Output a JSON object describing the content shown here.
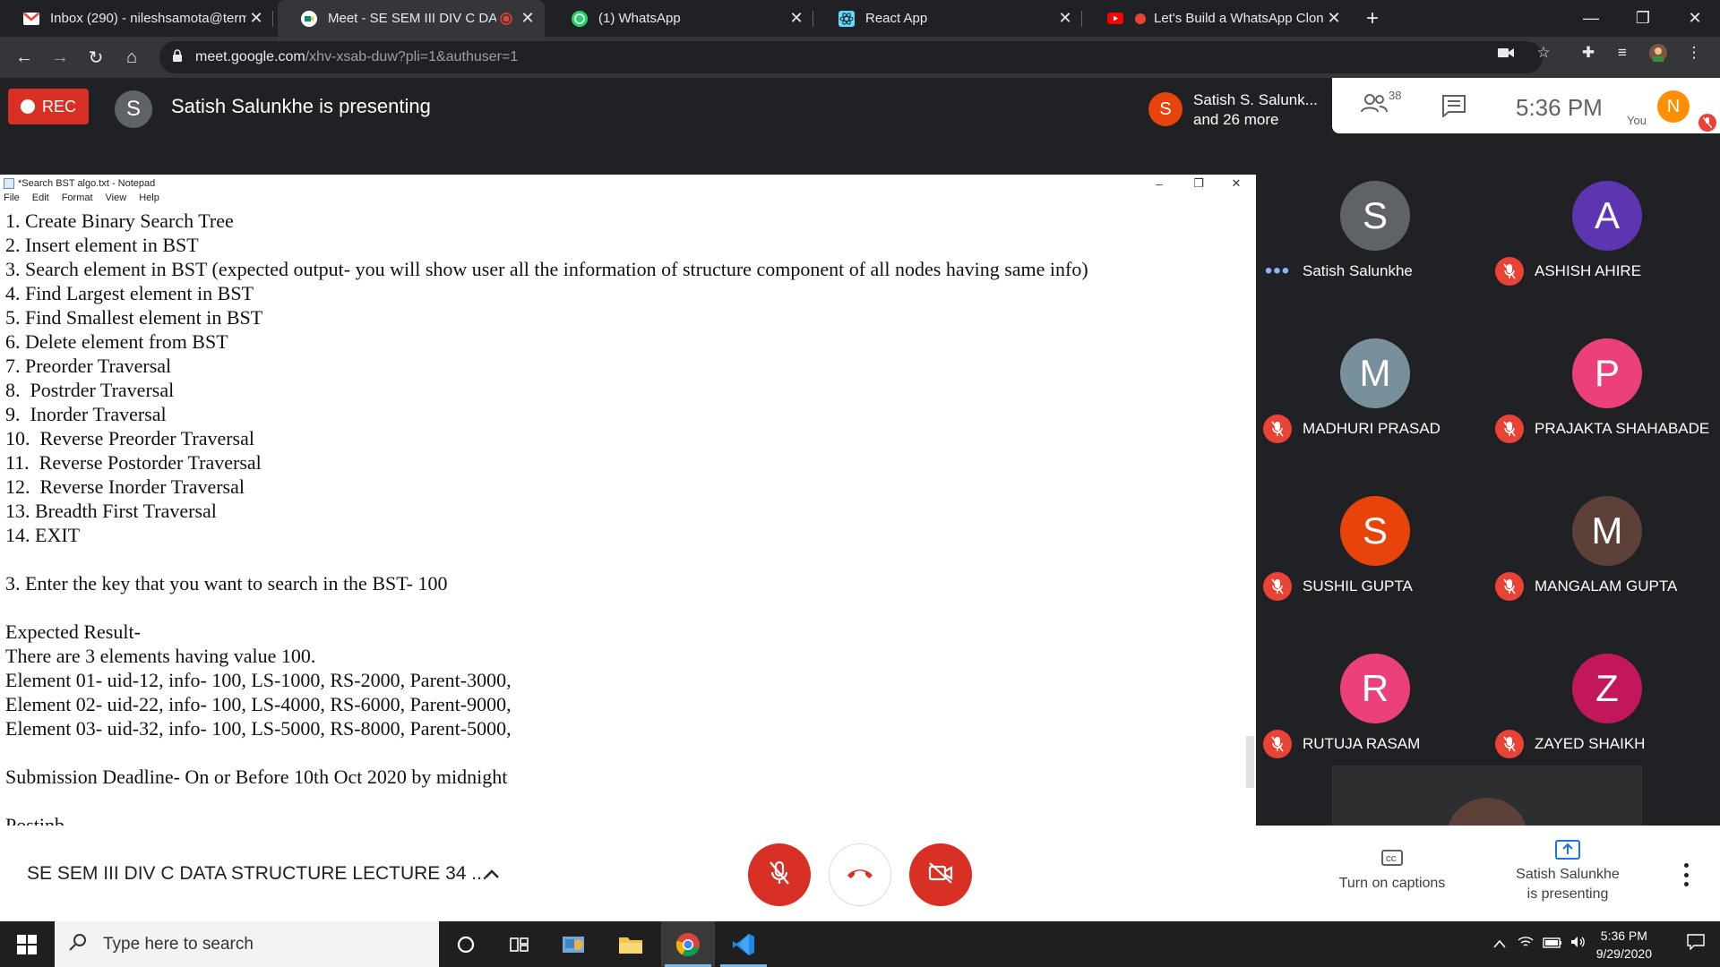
{
  "browser": {
    "tabs": [
      {
        "title": "Inbox (290) - nileshsamota@term",
        "favicon": "gmail-icon",
        "active": false
      },
      {
        "title": "Meet - SE SEM III DIV C DATA",
        "favicon": "google-meet-icon",
        "active": true,
        "recording": true
      },
      {
        "title": "(1) WhatsApp",
        "favicon": "whatsapp-icon",
        "active": false
      },
      {
        "title": "React App",
        "favicon": "react-icon",
        "active": false
      },
      {
        "title": "Let's Build a WhatsApp Clone",
        "favicon": "youtube-icon",
        "active": false,
        "recording": true
      }
    ],
    "url_host": "meet.google.com",
    "url_path": "/xhv-xsab-duw?pli=1&authuser=1"
  },
  "meet": {
    "rec_label": "REC",
    "presenter_initial": "S",
    "presenting_text": "Satish Salunkhe is presenting",
    "speaker": {
      "initial": "S",
      "line1": "Satish S. Salunk...",
      "line2": "and 26 more"
    },
    "participant_count": "38",
    "clock": "5:36 PM",
    "you_label": "You",
    "you_initial": "N",
    "participants": [
      {
        "initial": "S",
        "name": "Satish Salunkhe",
        "color": "#5f6368",
        "status": "speaking"
      },
      {
        "initial": "A",
        "name": "ASHISH AHIRE",
        "color": "#5e35b1",
        "status": "muted"
      },
      {
        "initial": "M",
        "name": "MADHURI PRASAD",
        "color": "#78909c",
        "status": "muted"
      },
      {
        "initial": "P",
        "name": "PRAJAKTA SHAHABADE",
        "color": "#ec407a",
        "status": "muted"
      },
      {
        "initial": "S",
        "name": "SUSHIL GUPTA",
        "color": "#e8430a",
        "status": "muted"
      },
      {
        "initial": "M",
        "name": "MANGALAM GUPTA",
        "color": "#5d4037",
        "status": "muted"
      },
      {
        "initial": "R",
        "name": "RUTUJA RASAM",
        "color": "#ec407a",
        "status": "muted"
      },
      {
        "initial": "Z",
        "name": "ZAYED SHAIKH",
        "color": "#c2185b",
        "status": "muted"
      }
    ],
    "meeting_title": "SE SEM III DIV C DATA STRUCTURE LECTURE 34 ...",
    "captions_label": "Turn on captions",
    "presenting_line1": "Satish Salunkhe",
    "presenting_line2": "is presenting"
  },
  "notepad": {
    "title": "*Search BST algo.txt - Notepad",
    "menu": [
      "File",
      "Edit",
      "Format",
      "View",
      "Help"
    ],
    "lines": [
      "1. Create Binary Search Tree",
      "2. Insert element in BST",
      "3. Search element in BST (expected output- you will show user all the information of structure component of all nodes having same info)",
      "4. Find Largest element in BST",
      "5. Find Smallest element in BST",
      "6. Delete element from BST",
      "7. Preorder Traversal",
      "8.  Postrder Traversal",
      "9.  Inorder Traversal",
      "10.  Reverse Preorder Traversal",
      "11.  Reverse Postorder Traversal",
      "12.  Reverse Inorder Traversal",
      "13. Breadth First Traversal",
      "14. EXIT",
      "",
      "3. Enter the key that you want to search in the BST- 100",
      "",
      "Expected Result-",
      "There are 3 elements having value 100.",
      "Element 01- uid-12, info- 100, LS-1000, RS-2000, Parent-3000,",
      "Element 02- uid-22, info- 100, LS-4000, RS-6000, Parent-9000,",
      "Element 03- uid-32, info- 100, LS-5000, RS-8000, Parent-5000,",
      "",
      "Submission Deadline- On or Before 10th Oct 2020 by midnight",
      "",
      "Postinb"
    ]
  },
  "taskbar": {
    "search_placeholder": "Type here to search",
    "time": "5:36 PM",
    "date": "9/29/2020"
  }
}
